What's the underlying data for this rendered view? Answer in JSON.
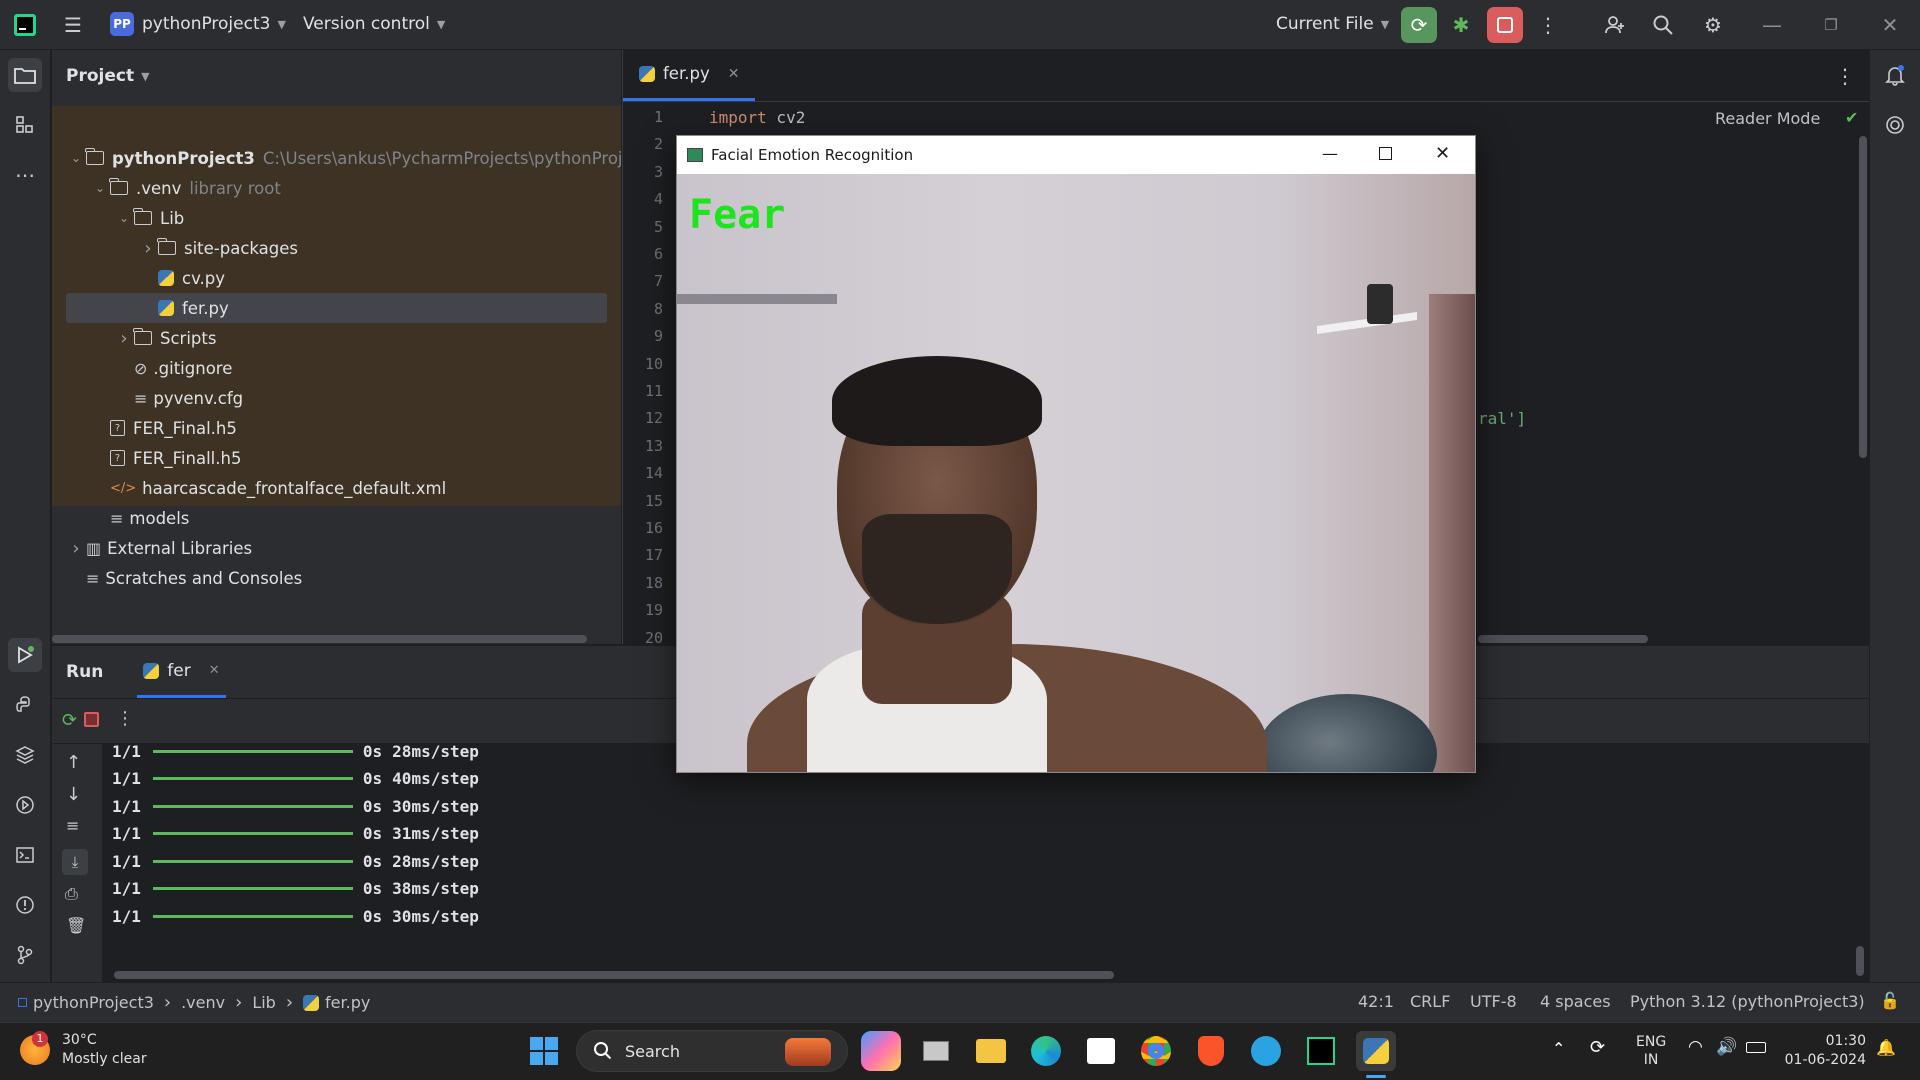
{
  "titlebar": {
    "project_badge": "PP",
    "project_name": "pythonProject3",
    "version_control": "Version control",
    "run_config": "Current File"
  },
  "project_panel": {
    "title": "Project",
    "tree": [
      {
        "label": "pythonProject3",
        "extra": "C:\\Users\\ankus\\PycharmProjects\\pythonProjec",
        "kind": "folder",
        "depth": 0,
        "expanded": true,
        "bold": true
      },
      {
        "label": ".venv",
        "extra": "library root",
        "kind": "folder",
        "depth": 1,
        "expanded": true
      },
      {
        "label": "Lib",
        "extra": "",
        "kind": "folder",
        "depth": 2,
        "expanded": true
      },
      {
        "label": "site-packages",
        "extra": "",
        "kind": "folder",
        "depth": 3,
        "expanded": false
      },
      {
        "label": "cv.py",
        "extra": "",
        "kind": "py",
        "depth": 3
      },
      {
        "label": "fer.py",
        "extra": "",
        "kind": "py",
        "depth": 3,
        "selected": true
      },
      {
        "label": "Scripts",
        "extra": "",
        "kind": "folder",
        "depth": 2,
        "expanded": false
      },
      {
        "label": ".gitignore",
        "extra": "",
        "kind": "ignore",
        "depth": 2
      },
      {
        "label": "pyvenv.cfg",
        "extra": "",
        "kind": "text",
        "depth": 2
      },
      {
        "label": "FER_Final.h5",
        "extra": "",
        "kind": "unknown",
        "depth": 1
      },
      {
        "label": "FER_Finall.h5",
        "extra": "",
        "kind": "unknown",
        "depth": 1
      },
      {
        "label": "haarcascade_frontalface_default.xml",
        "extra": "",
        "kind": "xml",
        "depth": 1
      },
      {
        "label": "models",
        "extra": "",
        "kind": "text",
        "depth": 1
      },
      {
        "label": "External Libraries",
        "extra": "",
        "kind": "lib",
        "depth": 0,
        "expanded": false
      },
      {
        "label": "Scratches and Consoles",
        "extra": "",
        "kind": "scratch",
        "depth": 0
      }
    ]
  },
  "editor": {
    "tab_label": "fer.py",
    "reader_mode": "Reader Mode",
    "line_numbers": [
      "1",
      "2",
      "3",
      "4",
      "5",
      "6",
      "7",
      "8",
      "9",
      "10",
      "11",
      "12",
      "13",
      "14",
      "15",
      "16",
      "17",
      "18",
      "19",
      "20"
    ],
    "code_line1_kw": "import",
    "code_line1_rest": " cv2",
    "code_line12_fragment": "ral']"
  },
  "run_panel": {
    "title": "Run",
    "tab_label": "fer",
    "lines": [
      {
        "step": "1/1",
        "time": "0s",
        "rate": "28ms/step"
      },
      {
        "step": "1/1",
        "time": "0s",
        "rate": "40ms/step"
      },
      {
        "step": "1/1",
        "time": "0s",
        "rate": "30ms/step"
      },
      {
        "step": "1/1",
        "time": "0s",
        "rate": "31ms/step"
      },
      {
        "step": "1/1",
        "time": "0s",
        "rate": "28ms/step"
      },
      {
        "step": "1/1",
        "time": "0s",
        "rate": "38ms/step"
      },
      {
        "step": "1/1",
        "time": "0s",
        "rate": "30ms/step"
      }
    ]
  },
  "cv_window": {
    "title": "Facial Emotion Recognition",
    "emotion_label": "Fear"
  },
  "statusbar": {
    "crumbs": [
      "pythonProject3",
      ".venv",
      "Lib",
      "fer.py"
    ],
    "position": "42:1",
    "line_ending": "CRLF",
    "encoding": "UTF-8",
    "indent": "4 spaces",
    "interpreter": "Python 3.12 (pythonProject3)"
  },
  "taskbar": {
    "weather_temp": "30°C",
    "weather_desc": "Mostly clear",
    "weather_badge": "1",
    "search_label": "Search",
    "lang_top": "ENG",
    "lang_bottom": "IN",
    "time": "01:30",
    "date": "01-06-2024"
  },
  "colors": {
    "accent": "#3574f0",
    "emotion_text": "#1fe31f",
    "stop_button": "#db5c5c",
    "run_button": "#57965c"
  }
}
